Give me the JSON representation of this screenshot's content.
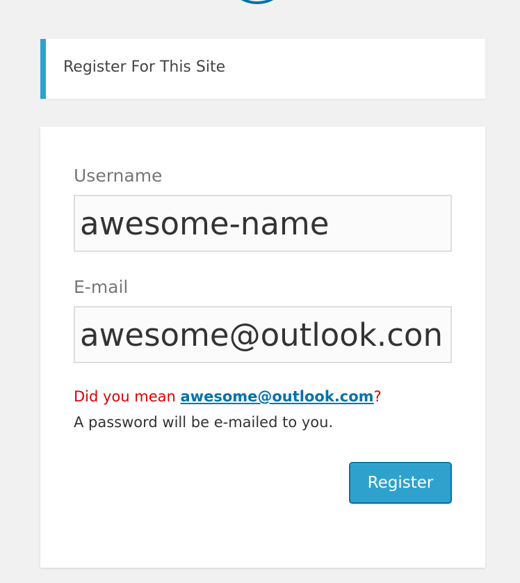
{
  "header": {
    "logo_icon": "wordpress-logo-icon"
  },
  "message": {
    "text": "Register For This Site"
  },
  "form": {
    "username_label": "Username",
    "username_value": "awesome-name",
    "email_label": "E-mail",
    "email_value": "awesome@outlook.con",
    "suggestion_prefix": "Did you mean ",
    "suggestion_link": "awesome@outlook.com",
    "suggestion_suffix": "?",
    "password_note": "A password will be e-mailed to you.",
    "register_label": "Register"
  },
  "colors": {
    "accent": "#2ea2cc",
    "button_border": "#0074a2",
    "error": "#dc0000",
    "link": "#0073aa",
    "background": "#f1f1f1"
  }
}
